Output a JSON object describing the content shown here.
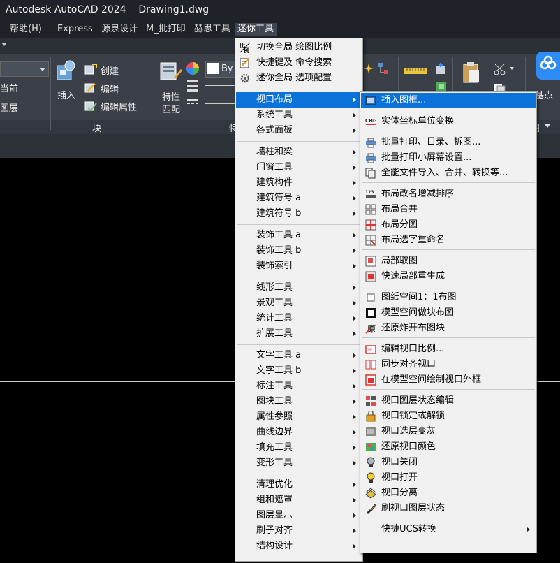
{
  "titlebar": {
    "title": "Autodesk AutoCAD 2024    Drawing1.dwg"
  },
  "menubar": {
    "items": [
      "帮助(H)",
      "Express",
      "源泉设计",
      "M_批打印",
      "赫思工具",
      "迷你工具"
    ]
  },
  "ribbon": {
    "left_labels": [
      "当前",
      "图层"
    ],
    "insert_label": "插入",
    "block_actions": [
      "创建",
      "编辑",
      "编辑属性"
    ],
    "block_panel_title": "块",
    "props_label_1": "特性",
    "props_label_2": "匹配",
    "bylayer_text": "By",
    "props_panel_title": "特",
    "basepoint_label": "基点",
    "right_panel_title": "图"
  },
  "top_items": [
    {
      "label": "切换全局 绘图比例",
      "icon": "scale-icon"
    },
    {
      "label": "快捷键及 命令搜索",
      "icon": "edit-icon"
    },
    {
      "label": "迷你全局 选项配置",
      "icon": "gear-icon"
    }
  ],
  "main_menu": {
    "groups": [
      [
        "视口布局",
        "系统工具",
        "各式面板"
      ],
      [
        "墙柱和梁",
        "门窗工具",
        "建筑构件",
        "建筑符号 a",
        "建筑符号 b"
      ],
      [
        "装饰工具 a",
        "装饰工具 b",
        "装饰索引"
      ],
      [
        "线形工具",
        "景观工具",
        "统计工具",
        "扩展工具"
      ],
      [
        "文字工具 a",
        "文字工具 b",
        "标注工具",
        "图块工具",
        "属性参照",
        "曲线边界",
        "填充工具",
        "变形工具"
      ],
      [
        "清理优化",
        "组和遮罩",
        "图层显示",
        "刷子对齐",
        "结构设计"
      ]
    ],
    "highlighted": "视口布局"
  },
  "submenu": {
    "groups": [
      [
        {
          "label": "插入图框...",
          "icon": "frame-icon"
        }
      ],
      [
        {
          "label": "实体坐标单位变换",
          "icon": "chg-icon",
          "glyph": "CHG"
        }
      ],
      [
        {
          "label": "批量打印、目录、拆图...",
          "icon": "printer-icon"
        },
        {
          "label": "批量打印小屏幕设置...",
          "icon": "printer-small-icon"
        },
        {
          "label": "全能文件导入、合并、转换等...",
          "icon": "file-copy-icon"
        }
      ],
      [
        {
          "label": "布局改名增减排序",
          "icon": "layout-rename-icon"
        },
        {
          "label": "布局合并",
          "icon": "layout-merge-icon"
        },
        {
          "label": "布局分图",
          "icon": "layout-split-icon"
        },
        {
          "label": "布局选字重命名",
          "icon": "layout-text-icon"
        }
      ],
      [
        {
          "label": "局部取图",
          "icon": "partial-pick-icon"
        },
        {
          "label": "快速局部重生成",
          "icon": "regen-icon"
        }
      ],
      [
        {
          "label": "图纸空间1：1布图",
          "icon": "paper-space-icon"
        },
        {
          "label": "模型空间做块布图",
          "icon": "model-block-icon"
        },
        {
          "label": "还原炸开布图块",
          "icon": "restore-explode-icon"
        }
      ],
      [
        {
          "label": "编辑视口比例...",
          "icon": "vp-scale-icon"
        },
        {
          "label": "同步对齐视口",
          "icon": "vp-align-icon"
        },
        {
          "label": "在模型空间绘制视口外框",
          "icon": "vp-frame-icon"
        }
      ],
      [
        {
          "label": "视口图层状态编辑",
          "icon": "vp-layer-state-icon"
        },
        {
          "label": "视口锁定或解锁",
          "icon": "vp-lock-icon"
        },
        {
          "label": "视口选层变灰",
          "icon": "vp-gray-icon"
        },
        {
          "label": "还原视口颜色",
          "icon": "vp-color-icon"
        },
        {
          "label": "视口关闭",
          "icon": "bulb-off-icon"
        },
        {
          "label": "视口打开",
          "icon": "bulb-on-icon"
        },
        {
          "label": "视口分离",
          "icon": "vp-detach-icon"
        },
        {
          "label": "刷视口图层状态",
          "icon": "brush-icon"
        }
      ],
      [
        {
          "label": "快捷UCS转换",
          "icon": "",
          "submenu": true
        }
      ]
    ],
    "highlighted": "插入图框..."
  }
}
